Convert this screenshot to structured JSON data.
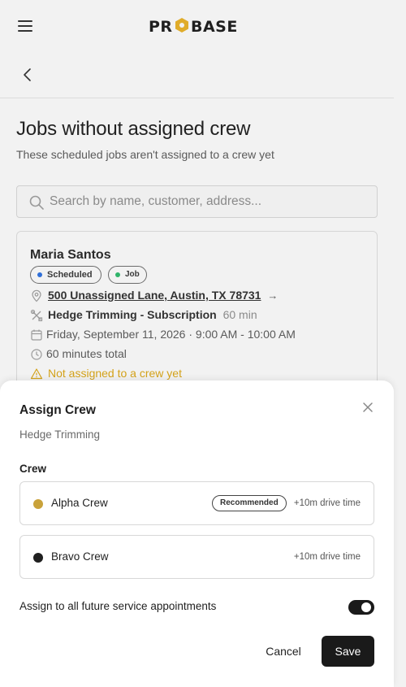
{
  "brand": {
    "logo_text": "PROBASE",
    "accent": "#e0ac2a"
  },
  "page": {
    "title": "Jobs without assigned crew",
    "subtitle": "These scheduled jobs aren't assigned to a crew yet"
  },
  "search": {
    "placeholder": "Search by name, customer, address..."
  },
  "job": {
    "customer": "Maria Santos",
    "status_badge": "Scheduled",
    "status_color": "#2f6fd8",
    "type_badge": "Job",
    "type_color": "#2fb46a",
    "address": "500 Unassigned Lane, Austin, TX 78731",
    "address_arrow": "→",
    "service": "Hedge Trimming - Subscription",
    "service_duration": "60 min",
    "schedule": "Friday, September 11, 2026 · 9:00 AM - 10:00 AM",
    "total": "60 minutes total",
    "warning": "Not assigned to a crew yet"
  },
  "assign_sheet": {
    "title": "Assign Crew",
    "subtitle": "Hedge Trimming",
    "crew_label": "Crew",
    "crews": [
      {
        "name": "Alpha Crew",
        "color": "#c9a23a",
        "badge": "Recommended",
        "drive": "+10m drive time"
      },
      {
        "name": "Bravo Crew",
        "color": "#1f1f1f",
        "badge": "",
        "drive": "+10m drive time"
      }
    ],
    "future_label": "Assign to all future service appointments",
    "future_enabled": true,
    "cancel_label": "Cancel",
    "save_label": "Save"
  }
}
